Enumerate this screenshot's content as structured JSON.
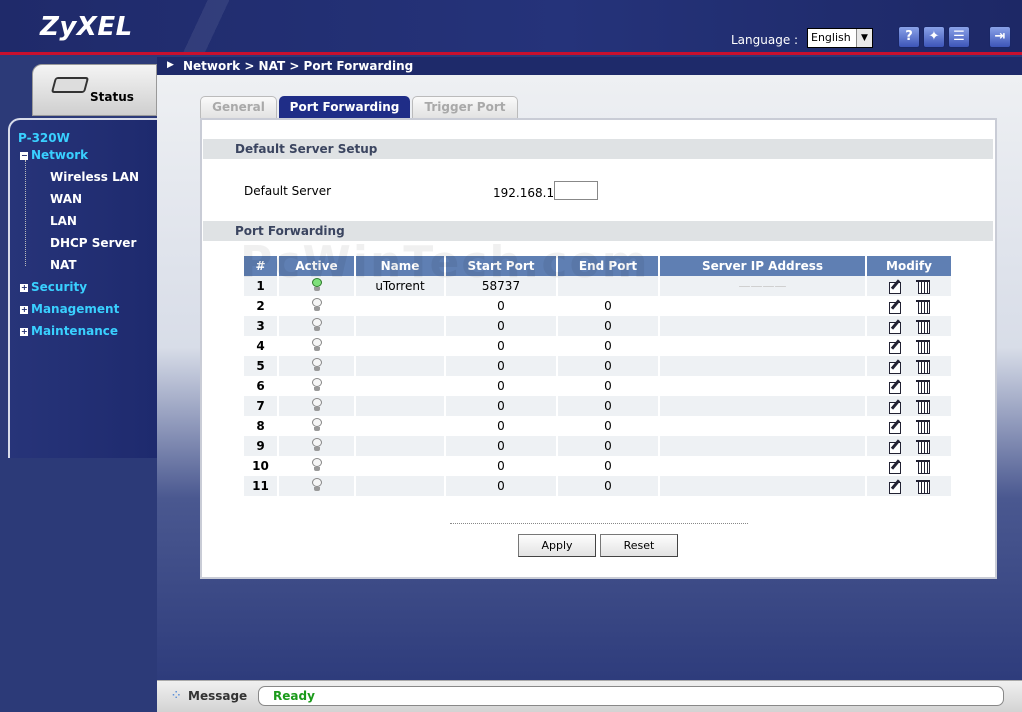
{
  "header": {
    "logo": "ZyXEL",
    "language_label": "Language :",
    "language_selected": "English",
    "icons": [
      "help-icon",
      "wizard-icon",
      "site-map-icon",
      "logout-icon"
    ],
    "help_glyph": "?"
  },
  "breadcrumb": "Network > NAT > Port Forwarding",
  "sidebar": {
    "status_label": "Status",
    "device": "P-320W",
    "network": "Network",
    "network_children": [
      "Wireless LAN",
      "WAN",
      "LAN",
      "DHCP Server",
      "NAT"
    ],
    "security": "Security",
    "management": "Management",
    "maintenance": "Maintenance"
  },
  "tabs": [
    "General",
    "Port Forwarding",
    "Trigger Port"
  ],
  "default_server": {
    "section_title": "Default Server Setup",
    "label": "Default Server",
    "ip_prefix": "192.168.1.",
    "ip_value": ""
  },
  "port_forwarding": {
    "section_title": "Port Forwarding",
    "columns": [
      "#",
      "Active",
      "Name",
      "Start Port",
      "End Port",
      "Server IP Address",
      "Modify"
    ],
    "rows": [
      {
        "num": "1",
        "active": true,
        "name": "uTorrent",
        "start": "58737",
        "end": "",
        "ip": "————"
      },
      {
        "num": "2",
        "active": false,
        "name": "",
        "start": "0",
        "end": "0",
        "ip": ""
      },
      {
        "num": "3",
        "active": false,
        "name": "",
        "start": "0",
        "end": "0",
        "ip": ""
      },
      {
        "num": "4",
        "active": false,
        "name": "",
        "start": "0",
        "end": "0",
        "ip": ""
      },
      {
        "num": "5",
        "active": false,
        "name": "",
        "start": "0",
        "end": "0",
        "ip": ""
      },
      {
        "num": "6",
        "active": false,
        "name": "",
        "start": "0",
        "end": "0",
        "ip": ""
      },
      {
        "num": "7",
        "active": false,
        "name": "",
        "start": "0",
        "end": "0",
        "ip": ""
      },
      {
        "num": "8",
        "active": false,
        "name": "",
        "start": "0",
        "end": "0",
        "ip": ""
      },
      {
        "num": "9",
        "active": false,
        "name": "",
        "start": "0",
        "end": "0",
        "ip": ""
      },
      {
        "num": "10",
        "active": false,
        "name": "",
        "start": "0",
        "end": "0",
        "ip": ""
      },
      {
        "num": "11",
        "active": false,
        "name": "",
        "start": "0",
        "end": "0",
        "ip": ""
      }
    ]
  },
  "buttons": {
    "apply": "Apply",
    "reset": "Reset"
  },
  "statusbar": {
    "label": "Message",
    "message": "Ready"
  },
  "watermark": "PcWinTech.com",
  "colors": {
    "accent": "#1f2d87",
    "header_blue": "#5f7fb3",
    "ready_green": "#1a9a1a",
    "nav_cyan": "#39d0ff"
  }
}
